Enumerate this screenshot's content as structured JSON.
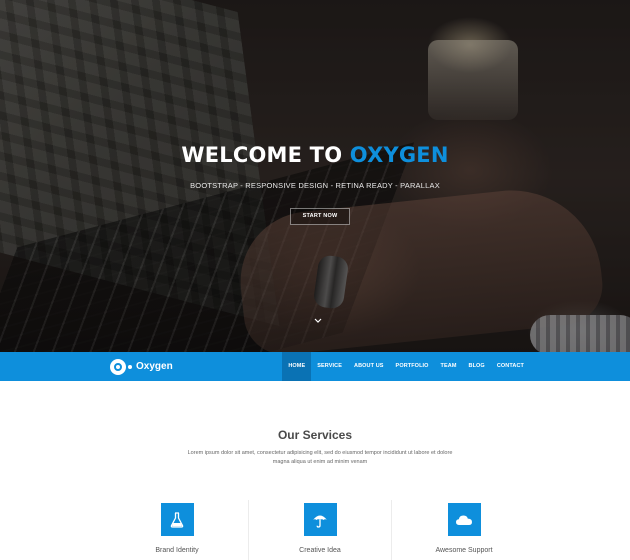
{
  "hero": {
    "title_main": "WELCOME TO ",
    "title_accent": "OXYGEN",
    "subtitle": "BOOTSTRAP - RESPONSIVE DESIGN - RETINA READY - PARALLAX",
    "cta_label": "START NOW",
    "scroll_icon": "chevron-down-icon"
  },
  "navbar": {
    "brand_name": "Oxygen",
    "brand_icon": "oxygen-logo-icon",
    "items": [
      {
        "label": "HOME",
        "active": true
      },
      {
        "label": "SERVICE",
        "active": false
      },
      {
        "label": "ABOUT US",
        "active": false
      },
      {
        "label": "PORTFOLIO",
        "active": false
      },
      {
        "label": "TEAM",
        "active": false
      },
      {
        "label": "BLOG",
        "active": false
      },
      {
        "label": "CONTACT",
        "active": false
      }
    ]
  },
  "services": {
    "title": "Our Services",
    "description": "Lorem ipsum dolor sit amet, consectetur adipisicing elit, sed do eiusmod tempor incididunt ut labore et dolore magna aliqua ut enim ad minim venam",
    "items": [
      {
        "label": "Brand Identity",
        "icon": "flask-icon"
      },
      {
        "label": "Creative Idea",
        "icon": "umbrella-icon"
      },
      {
        "label": "Awesome Support",
        "icon": "cloud-icon"
      }
    ]
  },
  "colors": {
    "accent": "#0e8fdc",
    "nav_active": "#0a72b4"
  }
}
